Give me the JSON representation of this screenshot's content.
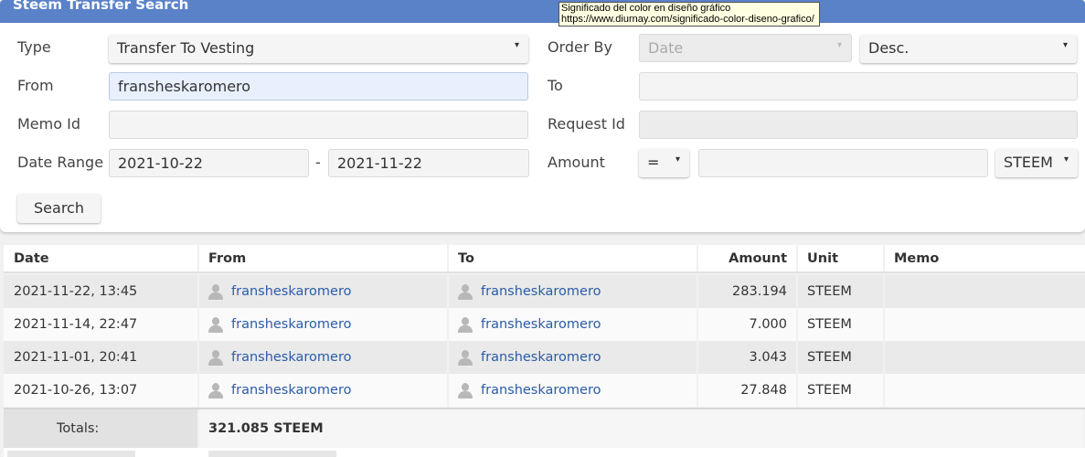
{
  "app": {
    "title": "Steem Transfer Search"
  },
  "form": {
    "type_label": "Type",
    "type_value": "Transfer To Vesting",
    "from_label": "From",
    "from_value": "fransheskaromero",
    "memo_label": "Memo Id",
    "memo_value": "",
    "date_label": "Date Range",
    "date_from": "2021-10-22",
    "date_sep": "-",
    "date_to": "2021-11-22",
    "order_label": "Order By",
    "order_value": "Date",
    "order_dir": "Desc.",
    "to_label": "To",
    "to_value": "",
    "request_label": "Request Id",
    "request_value": "",
    "amount_label": "Amount",
    "amount_op": "=",
    "amount_value": "",
    "amount_unit": "STEEM",
    "search_label": "Search"
  },
  "tooltip": {
    "line1": "Significado del color en diseño gráfico",
    "line2": "https://www.diurnay.com/significado-color-diseno-grafico/"
  },
  "table": {
    "headers": {
      "date": "Date",
      "from": "From",
      "to": "To",
      "amount": "Amount",
      "unit": "Unit",
      "memo": "Memo"
    },
    "rows": [
      {
        "date": "2021-11-22, 13:45",
        "from": "fransheskaromero",
        "to": "fransheskaromero",
        "amount": "283.194",
        "unit": "STEEM",
        "memo": ""
      },
      {
        "date": "2021-11-14, 22:47",
        "from": "fransheskaromero",
        "to": "fransheskaromero",
        "amount": "7.000",
        "unit": "STEEM",
        "memo": ""
      },
      {
        "date": "2021-11-01, 20:41",
        "from": "fransheskaromero",
        "to": "fransheskaromero",
        "amount": "3.043",
        "unit": "STEEM",
        "memo": ""
      },
      {
        "date": "2021-10-26, 13:07",
        "from": "fransheskaromero",
        "to": "fransheskaromero",
        "amount": "27.848",
        "unit": "STEEM",
        "memo": ""
      }
    ],
    "totals_label": "Totals:",
    "totals_value": "321.085 STEEM"
  },
  "colors": {
    "header": "#5a82c9",
    "link": "#2a5ca8",
    "focus_field": "#e8f0fe"
  },
  "icons": {
    "user": "user-icon",
    "dropdown": "chevron-down-icon"
  }
}
